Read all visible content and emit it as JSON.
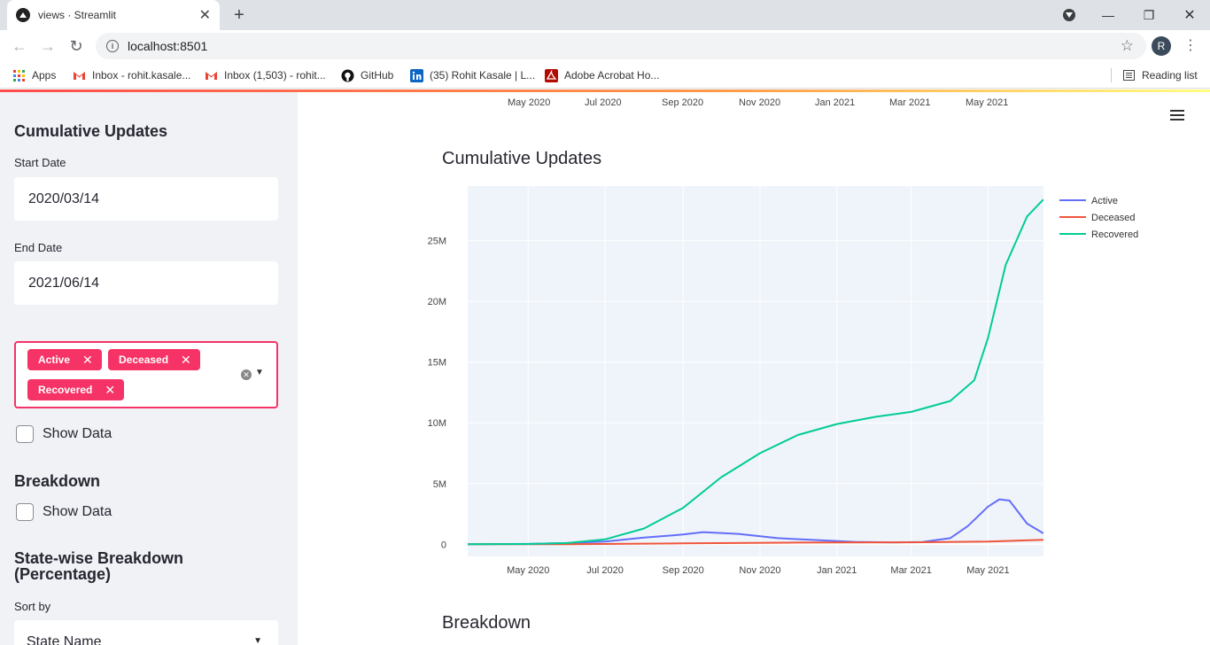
{
  "browser": {
    "tab_title": "views · Streamlit",
    "url": "localhost:8501",
    "profile_initial": "R",
    "bookmarks": [
      "Apps",
      "Inbox - rohit.kasale...",
      "Inbox (1,503) - rohit...",
      "GitHub",
      "(35) Rohit Kasale | L...",
      "Adobe Acrobat Ho..."
    ],
    "reading_list": "Reading list"
  },
  "sidebar": {
    "cumulative_title": "Cumulative Updates",
    "start_label": "Start Date",
    "start_value": "2020/03/14",
    "end_label": "End Date",
    "end_value": "2021/06/14",
    "chips": [
      "Active",
      "Deceased",
      "Recovered"
    ],
    "show_data_label": "Show Data",
    "breakdown_title": "Breakdown",
    "breakdown_show_data": "Show Data",
    "statewise_title_line1": "State-wise Breakdown",
    "statewise_title_line2": "(Percentage)",
    "sort_label": "Sort by",
    "sort_value": "State Name",
    "accent_color": "#f63366"
  },
  "main": {
    "top_axis_ticks": [
      "May 2020",
      "Jul 2020",
      "Sep 2020",
      "Nov 2020",
      "Jan 2021",
      "Mar 2021",
      "May 2021"
    ],
    "chart_title": "Cumulative Updates",
    "next_section_title": "Breakdown"
  },
  "chart_data": {
    "type": "line",
    "title": "Cumulative Updates",
    "xlabel": "",
    "ylabel": "",
    "x_ticks": [
      "May 2020",
      "Jul 2020",
      "Sep 2020",
      "Nov 2020",
      "Jan 2021",
      "Mar 2021",
      "May 2021"
    ],
    "y_ticks": [
      "0",
      "5M",
      "10M",
      "15M",
      "20M",
      "25M"
    ],
    "ylim": [
      -1000000,
      29500000
    ],
    "xlim": [
      "2020-03-14",
      "2021-06-14"
    ],
    "grid": true,
    "legend_position": "top-right",
    "series": [
      {
        "name": "Active",
        "color": "#636efa",
        "points": [
          [
            "2020-03-14",
            0
          ],
          [
            "2020-05-01",
            30000
          ],
          [
            "2020-06-01",
            100000
          ],
          [
            "2020-07-01",
            220000
          ],
          [
            "2020-08-01",
            550000
          ],
          [
            "2020-09-01",
            800000
          ],
          [
            "2020-09-17",
            1000000
          ],
          [
            "2020-10-15",
            850000
          ],
          [
            "2020-11-15",
            500000
          ],
          [
            "2020-12-15",
            350000
          ],
          [
            "2021-01-15",
            200000
          ],
          [
            "2021-02-15",
            150000
          ],
          [
            "2021-03-10",
            180000
          ],
          [
            "2021-04-01",
            500000
          ],
          [
            "2021-04-15",
            1500000
          ],
          [
            "2021-05-01",
            3100000
          ],
          [
            "2021-05-10",
            3700000
          ],
          [
            "2021-05-18",
            3600000
          ],
          [
            "2021-06-01",
            1700000
          ],
          [
            "2021-06-14",
            900000
          ]
        ]
      },
      {
        "name": "Deceased",
        "color": "#ef553b",
        "points": [
          [
            "2020-03-14",
            0
          ],
          [
            "2020-06-01",
            6000
          ],
          [
            "2020-09-01",
            70000
          ],
          [
            "2020-12-01",
            140000
          ],
          [
            "2021-03-01",
            158000
          ],
          [
            "2021-05-01",
            220000
          ],
          [
            "2021-06-14",
            375000
          ]
        ]
      },
      {
        "name": "Recovered",
        "color": "#00cc96",
        "points": [
          [
            "2020-03-14",
            0
          ],
          [
            "2020-05-01",
            20000
          ],
          [
            "2020-06-01",
            100000
          ],
          [
            "2020-07-01",
            400000
          ],
          [
            "2020-08-01",
            1300000
          ],
          [
            "2020-09-01",
            3000000
          ],
          [
            "2020-10-01",
            5500000
          ],
          [
            "2020-11-01",
            7500000
          ],
          [
            "2020-12-01",
            9000000
          ],
          [
            "2021-01-01",
            9900000
          ],
          [
            "2021-02-01",
            10500000
          ],
          [
            "2021-03-01",
            10900000
          ],
          [
            "2021-04-01",
            11800000
          ],
          [
            "2021-04-20",
            13500000
          ],
          [
            "2021-05-01",
            17000000
          ],
          [
            "2021-05-15",
            23000000
          ],
          [
            "2021-06-01",
            27000000
          ],
          [
            "2021-06-14",
            28400000
          ]
        ]
      }
    ]
  }
}
